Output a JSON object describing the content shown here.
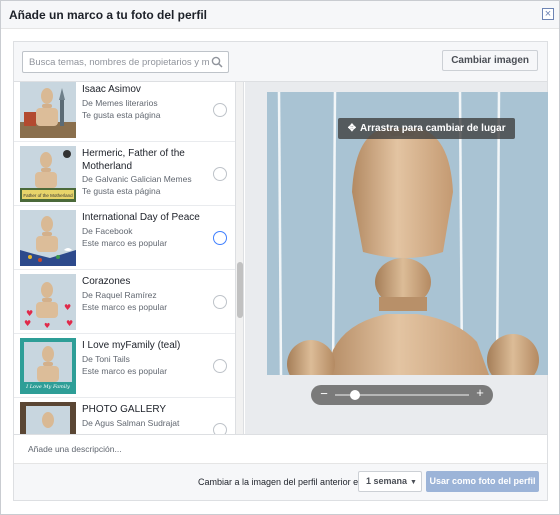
{
  "dialog": {
    "title": "Añade un marco a tu foto del perfil",
    "close_label": "×"
  },
  "search": {
    "placeholder": "Busca temas, nombres de propietarios y mucho más",
    "icon": "search-icon"
  },
  "change_image_label": "Cambiar imagen",
  "frames": [
    {
      "title": "Isaac Asimov",
      "owner": "De Memes literarios",
      "status": "Te gusta esta página",
      "selected": false
    },
    {
      "title": "Hermeric, Father of the Motherland",
      "owner": "De Galvanic Galician Memes",
      "status": "Te gusta esta página",
      "selected": false
    },
    {
      "title": "International Day of Peace",
      "owner": "De Facebook",
      "status": "Este marco es popular",
      "selected": true
    },
    {
      "title": "Corazones",
      "owner": "De Raquel Ramírez",
      "status": "Este marco es popular",
      "selected": false
    },
    {
      "title": "I Love myFamily (teal)",
      "owner": "De Toni Tails",
      "status": "Este marco es popular",
      "selected": false
    },
    {
      "title": "PHOTO GALLERY",
      "owner": "De Agus Salman Sudrajat",
      "status": "",
      "selected": false
    }
  ],
  "thumb_captions": {
    "hermeric": "Father of the Motherland",
    "family": "I Love My Family"
  },
  "preview": {
    "drag_label": "Arrastra para cambiar de lugar",
    "move_icon": "✥",
    "zoom_minus": "−",
    "zoom_plus": "+",
    "zoom_level": 0.15
  },
  "description_placeholder": "Añade una descripción...",
  "footer": {
    "revert_label": "Cambiar a la imagen del perfil anterior en",
    "duration_value": "1 semana",
    "use_button_label": "Usar como foto del perfil"
  },
  "colors": {
    "accent_blue": "#4080ff",
    "disabled_button": "#9cb4d8",
    "sky": "#a9c3d3",
    "wood": "#d8b48f"
  }
}
